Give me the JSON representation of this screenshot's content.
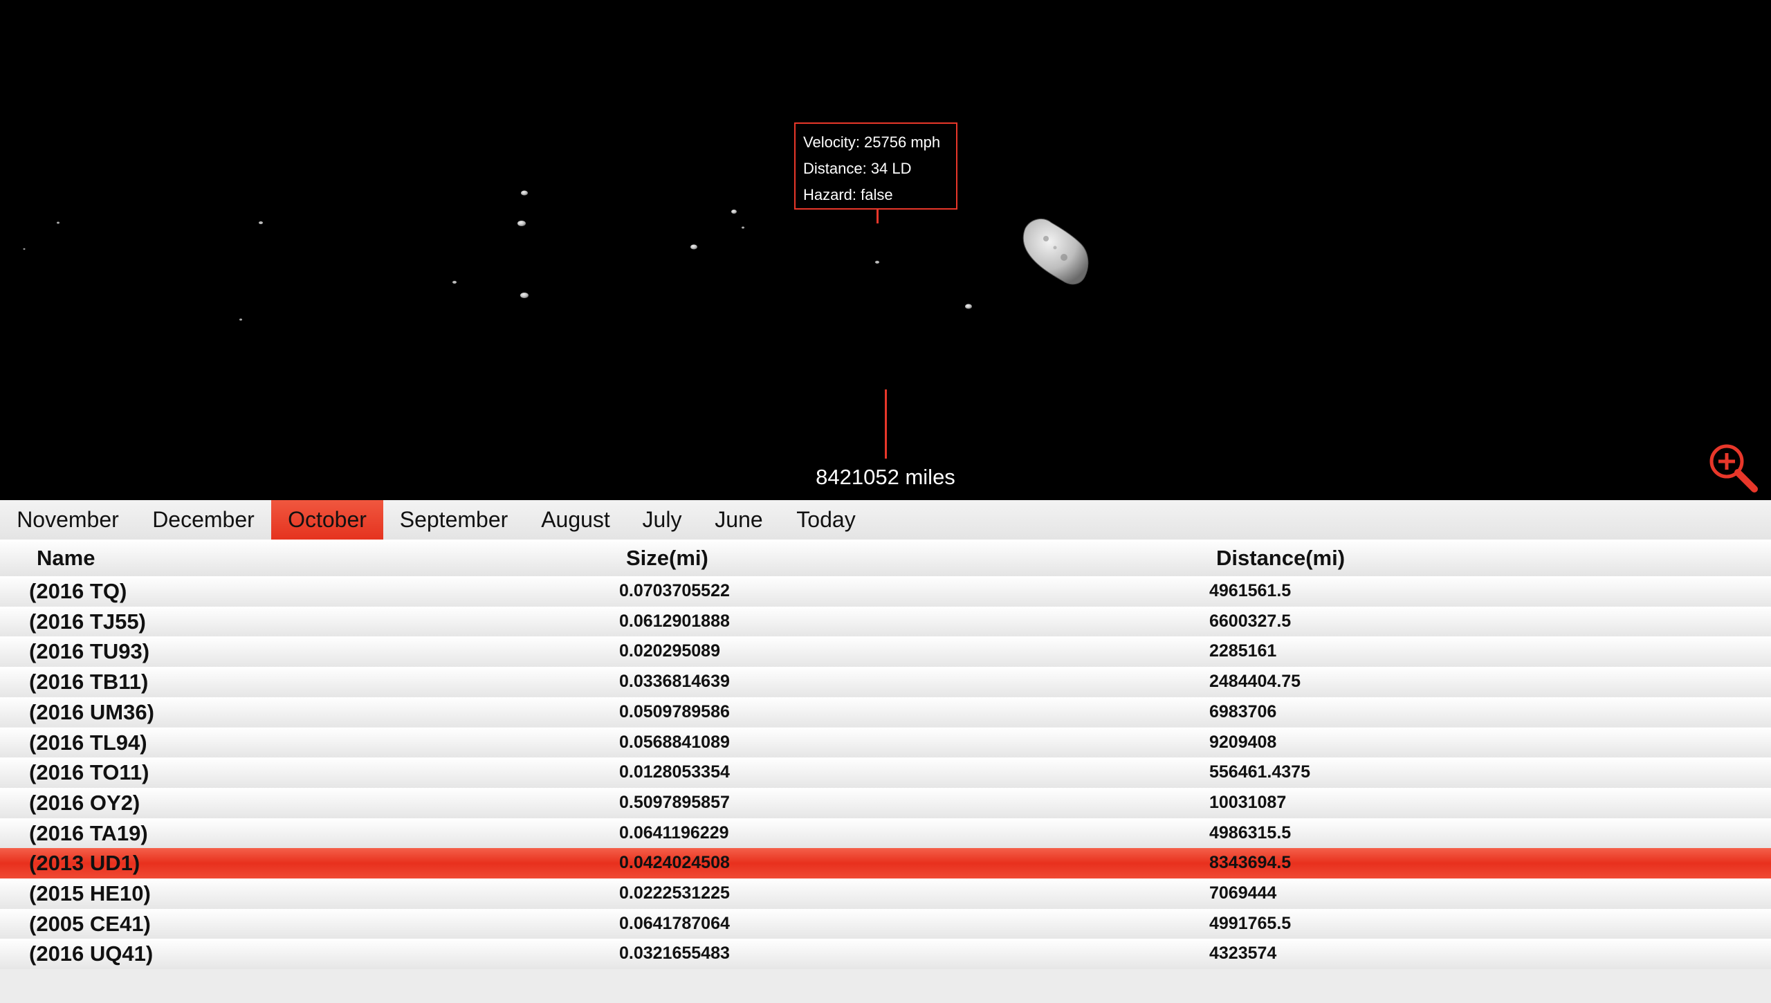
{
  "tooltip": {
    "velocity": "Velocity: 25756 mph",
    "distance": "Distance: 34 LD",
    "hazard": "Hazard: false"
  },
  "scale_label": "8421052 miles",
  "zoom_icon": "zoom-in-icon",
  "accent_color": "#e8372a",
  "tabs": [
    {
      "label": "November",
      "active": false
    },
    {
      "label": "December",
      "active": false
    },
    {
      "label": "October",
      "active": true
    },
    {
      "label": "September",
      "active": false
    },
    {
      "label": "August",
      "active": false
    },
    {
      "label": "July",
      "active": false
    },
    {
      "label": "June",
      "active": false
    },
    {
      "label": "Today",
      "active": false
    }
  ],
  "table": {
    "headers": {
      "name": "Name",
      "size": "Size(mi)",
      "distance": "Distance(mi)"
    },
    "rows": [
      {
        "name": "(2016 TQ)",
        "size": "0.0703705522",
        "distance": "4961561.5",
        "selected": false
      },
      {
        "name": "(2016 TJ55)",
        "size": "0.0612901888",
        "distance": "6600327.5",
        "selected": false
      },
      {
        "name": "(2016 TU93)",
        "size": "0.020295089",
        "distance": "2285161",
        "selected": false
      },
      {
        "name": "(2016 TB11)",
        "size": "0.0336814639",
        "distance": "2484404.75",
        "selected": false
      },
      {
        "name": "(2016 UM36)",
        "size": "0.0509789586",
        "distance": "6983706",
        "selected": false
      },
      {
        "name": "(2016 TL94)",
        "size": "0.0568841089",
        "distance": "9209408",
        "selected": false
      },
      {
        "name": "(2016 TO11)",
        "size": "0.0128053354",
        "distance": "556461.4375",
        "selected": false
      },
      {
        "name": "(2016 OY2)",
        "size": "0.5097895857",
        "distance": "10031087",
        "selected": false
      },
      {
        "name": "(2016 TA19)",
        "size": "0.0641196229",
        "distance": "4986315.5",
        "selected": false
      },
      {
        "name": "(2013 UD1)",
        "size": "0.0424024508",
        "distance": "8343694.5",
        "selected": true
      },
      {
        "name": "(2015 HE10)",
        "size": "0.0222531225",
        "distance": "7069444",
        "selected": false
      },
      {
        "name": "(2005 CE41)",
        "size": "0.0641787064",
        "distance": "4991765.5",
        "selected": false
      },
      {
        "name": "(2016 UQ41)",
        "size": "0.0321655483",
        "distance": "4323574",
        "selected": false
      }
    ]
  }
}
